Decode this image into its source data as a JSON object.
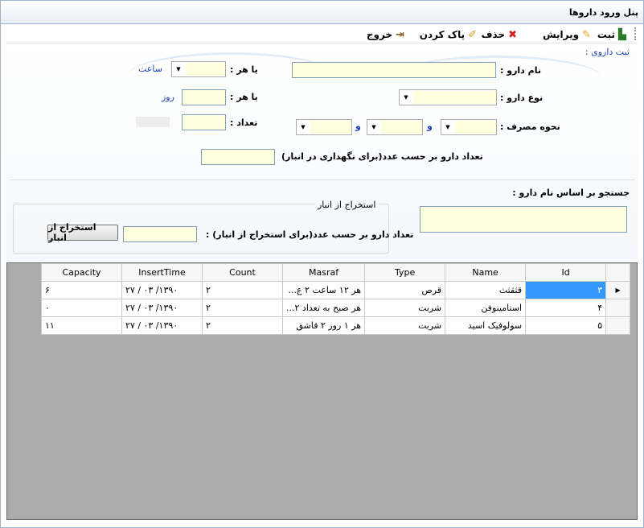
{
  "window": {
    "title": "پنل ورود داروها"
  },
  "toolbar": {
    "save": "ثبت",
    "edit": "ویرایش",
    "delete": "حذف",
    "clear": "پاک کردن",
    "exit": "خروج"
  },
  "form": {
    "section_title": "ثبت داروی :",
    "drug_name_label": "نام دارو :",
    "drug_type_label": "نوع دارو :",
    "usage_label": "نحوه مصرف :",
    "every_label_1": "یا هر :",
    "every_label_2": "یا هر :",
    "hour_unit": "ساعت",
    "day_unit": "روز",
    "count_label": "تعداد :",
    "and_1": "و",
    "and_2": "و",
    "stock_count_label": "تعداد دارو بر حسب عدد(برای نگهداری در انبار)"
  },
  "search": {
    "label": "جستجو بر اساس نام دارو :"
  },
  "extract": {
    "group_title": "استخراج از انبار",
    "count_label": "تعداد دارو بر حسب عدد(برای استخراج از انبار) :",
    "button": "استخراج از انبار"
  },
  "grid": {
    "columns": [
      "Id",
      "Name",
      "Type",
      "Masraf",
      "Count",
      "InsertTime",
      "Capacity"
    ],
    "rows": [
      {
        "id": "۳",
        "name": "قثقثث",
        "type": "قرص",
        "masraf": "هر ۱۲ ساعت ۲ ع...",
        "count": "۲",
        "insert": "۲۷ / ۰۳ /۱۳۹۰",
        "capacity": "۶"
      },
      {
        "id": "۴",
        "name": "استامینوفن",
        "type": "شربت",
        "masraf": "هر صبح به تعداد ۲...",
        "count": "۲",
        "insert": "۲۷ / ۰۳ /۱۳۹۰",
        "capacity": "۰"
      },
      {
        "id": "۵",
        "name": "سولوفیک اسید",
        "type": "شربت",
        "masraf": "هر ۱ روز ۲ قاشق",
        "count": "۲",
        "insert": "۲۷ / ۰۳ /۱۳۹۰",
        "capacity": "۱۱"
      }
    ],
    "current_row_marker": "▶"
  },
  "colors": {
    "field_bg": "#ffffde",
    "selection": "#3399ff",
    "unit_blue": "#1c3fb8",
    "grid_bg": "#ababab"
  },
  "icons": [
    "bar-chart-icon",
    "pencil-icon",
    "red-x-icon",
    "eraser-icon",
    "exit-door-icon",
    "dropdown-arrow-icon"
  ]
}
